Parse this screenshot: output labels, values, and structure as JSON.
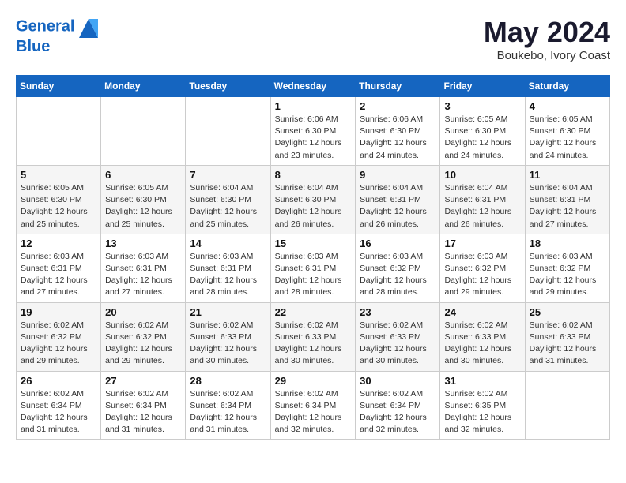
{
  "header": {
    "logo_line1": "General",
    "logo_line2": "Blue",
    "month": "May 2024",
    "location": "Boukebo, Ivory Coast"
  },
  "weekdays": [
    "Sunday",
    "Monday",
    "Tuesday",
    "Wednesday",
    "Thursday",
    "Friday",
    "Saturday"
  ],
  "weeks": [
    [
      {
        "day": "",
        "info": ""
      },
      {
        "day": "",
        "info": ""
      },
      {
        "day": "",
        "info": ""
      },
      {
        "day": "1",
        "info": "Sunrise: 6:06 AM\nSunset: 6:30 PM\nDaylight: 12 hours\nand 23 minutes."
      },
      {
        "day": "2",
        "info": "Sunrise: 6:06 AM\nSunset: 6:30 PM\nDaylight: 12 hours\nand 24 minutes."
      },
      {
        "day": "3",
        "info": "Sunrise: 6:05 AM\nSunset: 6:30 PM\nDaylight: 12 hours\nand 24 minutes."
      },
      {
        "day": "4",
        "info": "Sunrise: 6:05 AM\nSunset: 6:30 PM\nDaylight: 12 hours\nand 24 minutes."
      }
    ],
    [
      {
        "day": "5",
        "info": "Sunrise: 6:05 AM\nSunset: 6:30 PM\nDaylight: 12 hours\nand 25 minutes."
      },
      {
        "day": "6",
        "info": "Sunrise: 6:05 AM\nSunset: 6:30 PM\nDaylight: 12 hours\nand 25 minutes."
      },
      {
        "day": "7",
        "info": "Sunrise: 6:04 AM\nSunset: 6:30 PM\nDaylight: 12 hours\nand 25 minutes."
      },
      {
        "day": "8",
        "info": "Sunrise: 6:04 AM\nSunset: 6:30 PM\nDaylight: 12 hours\nand 26 minutes."
      },
      {
        "day": "9",
        "info": "Sunrise: 6:04 AM\nSunset: 6:31 PM\nDaylight: 12 hours\nand 26 minutes."
      },
      {
        "day": "10",
        "info": "Sunrise: 6:04 AM\nSunset: 6:31 PM\nDaylight: 12 hours\nand 26 minutes."
      },
      {
        "day": "11",
        "info": "Sunrise: 6:04 AM\nSunset: 6:31 PM\nDaylight: 12 hours\nand 27 minutes."
      }
    ],
    [
      {
        "day": "12",
        "info": "Sunrise: 6:03 AM\nSunset: 6:31 PM\nDaylight: 12 hours\nand 27 minutes."
      },
      {
        "day": "13",
        "info": "Sunrise: 6:03 AM\nSunset: 6:31 PM\nDaylight: 12 hours\nand 27 minutes."
      },
      {
        "day": "14",
        "info": "Sunrise: 6:03 AM\nSunset: 6:31 PM\nDaylight: 12 hours\nand 28 minutes."
      },
      {
        "day": "15",
        "info": "Sunrise: 6:03 AM\nSunset: 6:31 PM\nDaylight: 12 hours\nand 28 minutes."
      },
      {
        "day": "16",
        "info": "Sunrise: 6:03 AM\nSunset: 6:32 PM\nDaylight: 12 hours\nand 28 minutes."
      },
      {
        "day": "17",
        "info": "Sunrise: 6:03 AM\nSunset: 6:32 PM\nDaylight: 12 hours\nand 29 minutes."
      },
      {
        "day": "18",
        "info": "Sunrise: 6:03 AM\nSunset: 6:32 PM\nDaylight: 12 hours\nand 29 minutes."
      }
    ],
    [
      {
        "day": "19",
        "info": "Sunrise: 6:02 AM\nSunset: 6:32 PM\nDaylight: 12 hours\nand 29 minutes."
      },
      {
        "day": "20",
        "info": "Sunrise: 6:02 AM\nSunset: 6:32 PM\nDaylight: 12 hours\nand 29 minutes."
      },
      {
        "day": "21",
        "info": "Sunrise: 6:02 AM\nSunset: 6:33 PM\nDaylight: 12 hours\nand 30 minutes."
      },
      {
        "day": "22",
        "info": "Sunrise: 6:02 AM\nSunset: 6:33 PM\nDaylight: 12 hours\nand 30 minutes."
      },
      {
        "day": "23",
        "info": "Sunrise: 6:02 AM\nSunset: 6:33 PM\nDaylight: 12 hours\nand 30 minutes."
      },
      {
        "day": "24",
        "info": "Sunrise: 6:02 AM\nSunset: 6:33 PM\nDaylight: 12 hours\nand 30 minutes."
      },
      {
        "day": "25",
        "info": "Sunrise: 6:02 AM\nSunset: 6:33 PM\nDaylight: 12 hours\nand 31 minutes."
      }
    ],
    [
      {
        "day": "26",
        "info": "Sunrise: 6:02 AM\nSunset: 6:34 PM\nDaylight: 12 hours\nand 31 minutes."
      },
      {
        "day": "27",
        "info": "Sunrise: 6:02 AM\nSunset: 6:34 PM\nDaylight: 12 hours\nand 31 minutes."
      },
      {
        "day": "28",
        "info": "Sunrise: 6:02 AM\nSunset: 6:34 PM\nDaylight: 12 hours\nand 31 minutes."
      },
      {
        "day": "29",
        "info": "Sunrise: 6:02 AM\nSunset: 6:34 PM\nDaylight: 12 hours\nand 32 minutes."
      },
      {
        "day": "30",
        "info": "Sunrise: 6:02 AM\nSunset: 6:34 PM\nDaylight: 12 hours\nand 32 minutes."
      },
      {
        "day": "31",
        "info": "Sunrise: 6:02 AM\nSunset: 6:35 PM\nDaylight: 12 hours\nand 32 minutes."
      },
      {
        "day": "",
        "info": ""
      }
    ]
  ]
}
